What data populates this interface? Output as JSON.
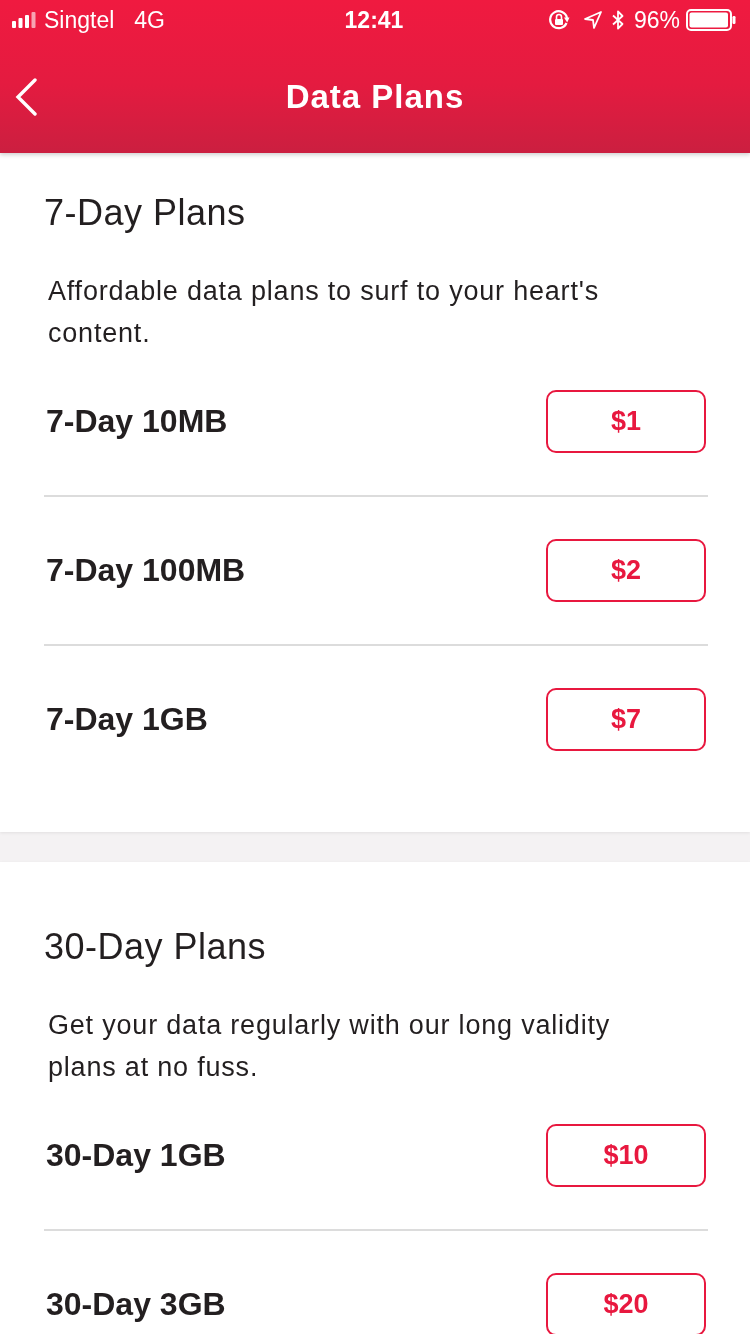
{
  "status_bar": {
    "carrier": "Singtel",
    "network": "4G",
    "time": "12:41",
    "battery_percent": "96%"
  },
  "header": {
    "title": "Data Plans"
  },
  "sections": [
    {
      "title": "7-Day Plans",
      "description": "Affordable data plans to surf to your heart's content.",
      "plans": [
        {
          "name": "7-Day 10MB",
          "price": "$1"
        },
        {
          "name": "7-Day 100MB",
          "price": "$2"
        },
        {
          "name": "7-Day 1GB",
          "price": "$7"
        }
      ]
    },
    {
      "title": "30-Day Plans",
      "description": "Get your data regularly with our long validity plans at no fuss.",
      "plans": [
        {
          "name": "30-Day 1GB",
          "price": "$10"
        },
        {
          "name": "30-Day 3GB",
          "price": "$20"
        }
      ]
    }
  ]
}
